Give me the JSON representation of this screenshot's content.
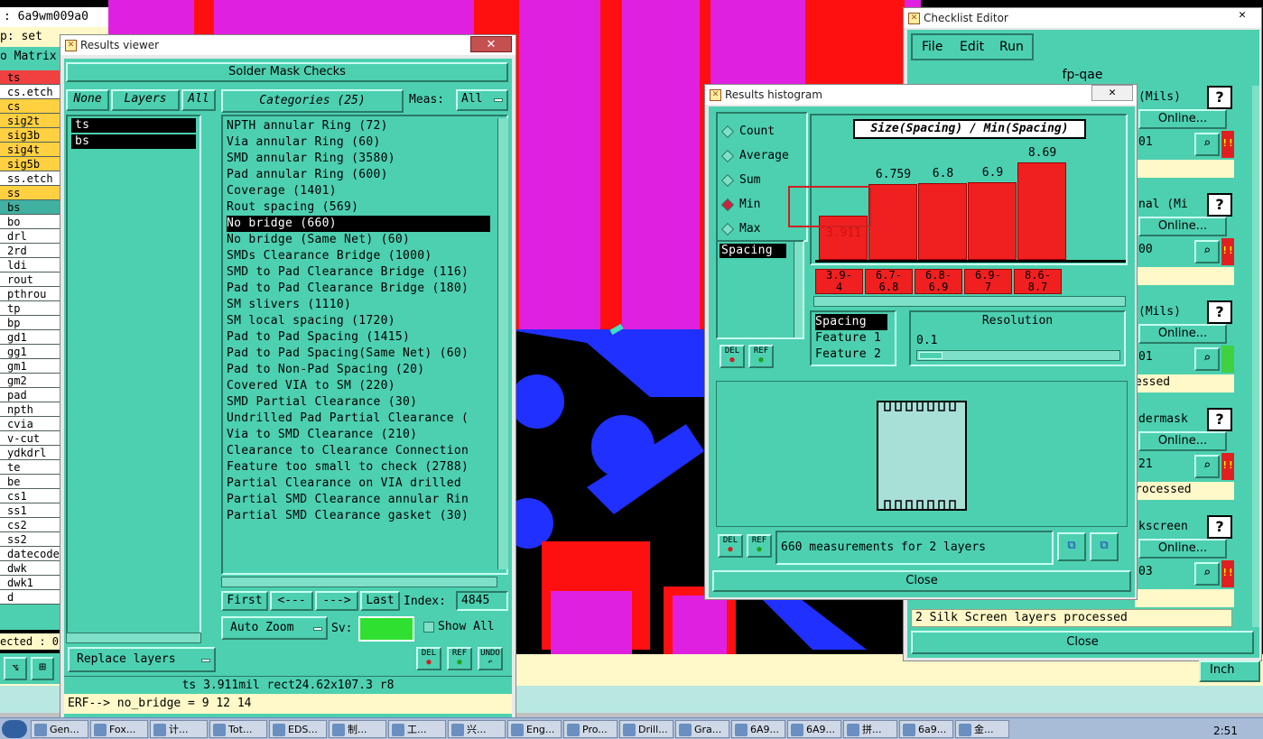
{
  "topleft": {
    "line1": ": 6a9wm009a0",
    "line2": "p: set",
    "line3": "o Matrix"
  },
  "left_layers": [
    "ts",
    "cs.etch",
    "cs",
    "sig2t",
    "sig3b",
    "sig4t",
    "sig5b",
    "ss.etch",
    "ss",
    "bs",
    "bo",
    "drl",
    "2rd",
    "ldi",
    "rout",
    "pthrou",
    "tp",
    "bp",
    "gd1",
    "gg1",
    "gm1",
    "gm2",
    "pad",
    "npth",
    "cvia",
    "v-cut",
    "ydkdrl",
    "te",
    "be",
    "cs1",
    "ss1",
    "cs2",
    "ss2",
    "datecode",
    "dwk",
    "dwk1",
    "d"
  ],
  "left_bottom": {
    "selected_text": "ected : 0"
  },
  "results_viewer": {
    "title": "Results viewer",
    "header": "Solder Mask Checks",
    "none_btn": "None",
    "layers_btn": "Layers",
    "all_btn": "All",
    "layers": [
      "ts",
      "bs"
    ],
    "categories_btn": "Categories (25)",
    "meas_label": "Meas:",
    "meas_value": "All",
    "categories": [
      "NPTH annular Ring (72)",
      "Via annular Ring (60)",
      "SMD annular Ring (3580)",
      "Pad annular Ring (600)",
      "Coverage (1401)",
      "Rout spacing (569)",
      "No bridge (660)",
      "No bridge (Same Net) (60)",
      "SMDs Clearance Bridge (1000)",
      "SMD to Pad Clearance Bridge (116)",
      "Pad to Pad Clearance Bridge (180)",
      "SM slivers (1110)",
      "SM local spacing (1720)",
      "Pad to Pad Spacing (1415)",
      "Pad to Pad Spacing(Same Net) (60)",
      "Pad to Non-Pad Spacing (20)",
      "Covered VIA to SM (220)",
      "SMD Partial Clearance (30)",
      "Undrilled Pad Partial Clearance (",
      "Via to SMD Clearance (210)",
      "Clearance to Clearance Connection",
      "Feature too small to check (2788)",
      "Partial Clearance on VIA drilled",
      "Partial SMD Clearance annular Rin",
      "Partial SMD Clearance gasket (30)"
    ],
    "selected_index": 6,
    "first_btn": "First",
    "prev_btn": "<---",
    "next_btn": "--->",
    "last_btn": "Last",
    "index_label": "Index:",
    "index_value": "4845",
    "auto_zoom": "Auto Zoom",
    "sv_label": "Sv:",
    "show_all": "Show All",
    "replace_layers": "Replace layers",
    "del": "DEL",
    "ref": "REF",
    "undo": "UNDO",
    "status": "ts 3.911mil  rect24.62x107.3  r8",
    "erf": "ERF--> no_bridge = 9 12 14"
  },
  "histogram": {
    "title": "Results histogram",
    "options": [
      "Count",
      "Average",
      "Sum",
      "Min",
      "Max"
    ],
    "selected_option": "Min",
    "chart_title": "Size(Spacing) / Min(Spacing)",
    "list_item": "Spacing",
    "sort_items": [
      "Spacing",
      "Feature 1",
      "Feature 2"
    ],
    "resolution_label": "Resolution",
    "resolution_value": "0.1",
    "del": "DEL",
    "ref": "REF",
    "measurements": "660 measurements for 2 layers",
    "close": "Close"
  },
  "chart_data": {
    "type": "bar",
    "title": "Size(Spacing) / Min(Spacing)",
    "categories": [
      "3.9-4",
      "6.7-6.8",
      "6.8-6.9",
      "6.9-7",
      "8.6-8.7"
    ],
    "values": [
      3.911,
      6.759,
      6.8,
      6.9,
      8.69
    ],
    "value_labels": [
      "3.911",
      "6.759",
      "6.8",
      "6.9",
      "8.69"
    ],
    "cat_top": [
      "3.9-",
      "6.7-",
      "6.8-",
      "6.9-",
      "8.6-"
    ],
    "cat_bot": [
      "4",
      "6.8",
      "6.9",
      "7",
      "8.7"
    ],
    "ylim": [
      0,
      9
    ],
    "colors": {
      "bar": "#f02020"
    }
  },
  "checklist": {
    "title": "Checklist Editor",
    "menu": [
      "File",
      "Edit",
      "Run"
    ],
    "name": "fp-qae",
    "rows": [
      {
        "label": "(Mils)",
        "online": "Online...",
        "status": "01",
        "mark": "!!"
      },
      {
        "label": "nal (Mi",
        "online": "Online...",
        "status": "00",
        "mark": "!!"
      },
      {
        "label": "(Mils)",
        "online": "Online...",
        "status": "01",
        "sub": "essed",
        "mark": ""
      },
      {
        "label": "dermask",
        "online": "Online...",
        "status": "21",
        "sub": "rocessed",
        "mark": "!!"
      },
      {
        "label": "kscreen",
        "online": "Online...",
        "status": "03",
        "mark": "!!"
      }
    ],
    "footer_msg": "2 Silk Screen layers processed",
    "close": "Close",
    "inch": "Inch"
  },
  "taskbar": {
    "items": [
      "Gen...",
      "Fox...",
      "计...",
      "Tot...",
      "EDS...",
      "制...",
      "工...",
      "兴...",
      "Eng...",
      "Pro...",
      "Drill...",
      "Gra...",
      "6A9...",
      "6A9...",
      "拼...",
      "6a9...",
      "金..."
    ],
    "clock": "2:51"
  }
}
